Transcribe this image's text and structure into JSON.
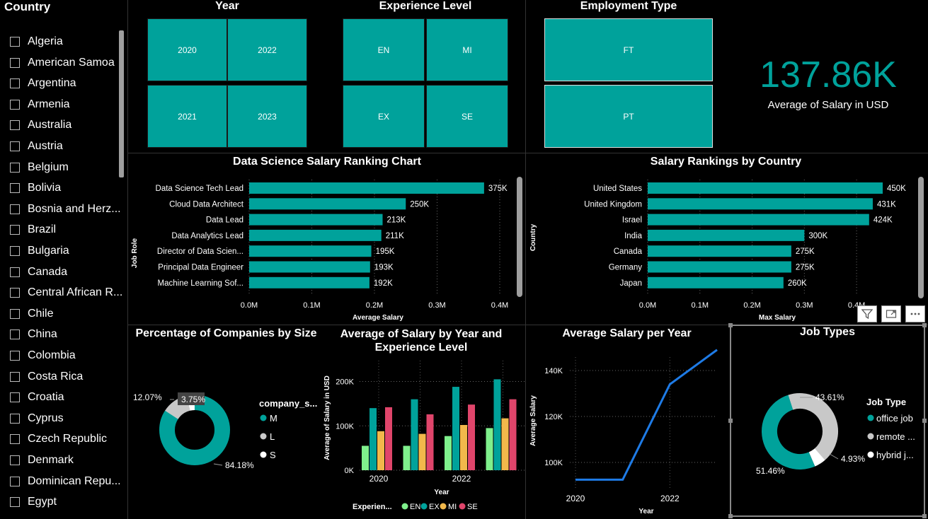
{
  "sidebar": {
    "title": "Country",
    "countries": [
      "Algeria",
      "American Samoa",
      "Argentina",
      "Armenia",
      "Australia",
      "Austria",
      "Belgium",
      "Bolivia",
      "Bosnia and Herz...",
      "Brazil",
      "Bulgaria",
      "Canada",
      "Central African R...",
      "Chile",
      "China",
      "Colombia",
      "Costa Rica",
      "Croatia",
      "Cyprus",
      "Czech Republic",
      "Denmark",
      "Dominican Repu...",
      "Egypt"
    ]
  },
  "slicers": {
    "year": {
      "title": "Year",
      "options": [
        "2020",
        "2022",
        "2021",
        "2023"
      ]
    },
    "experience": {
      "title": "Experience Level",
      "options": [
        "EN",
        "MI",
        "EX",
        "SE"
      ]
    },
    "employment": {
      "title": "Employment Type",
      "options": [
        "FT",
        "PT"
      ]
    }
  },
  "kpi": {
    "value": "137.86K",
    "label": "Average of Salary in USD"
  },
  "colors": {
    "teal": "#00a29b",
    "line": "#1e7be6",
    "en": "#7ff08c",
    "mi": "#f2b84b",
    "se": "#e0456b",
    "grey": "#c8c8c8"
  },
  "chart_data": [
    {
      "id": "role",
      "type": "bar",
      "orientation": "horizontal",
      "title": "Data Science Salary Ranking Chart",
      "xlabel": "Average Salary",
      "ylabel": "Job Role",
      "categories": [
        "Data Science Tech Lead",
        "Cloud Data Architect",
        "Data Lead",
        "Data Analytics Lead",
        "Director of Data Scien...",
        "Principal Data Engineer",
        "Machine Learning Sof..."
      ],
      "values": [
        375000,
        250000,
        213000,
        211000,
        195000,
        193000,
        192000
      ],
      "data_labels": [
        "375K",
        "250K",
        "213K",
        "211K",
        "195K",
        "193K",
        "192K"
      ],
      "xlim": [
        0,
        400000
      ],
      "xticks": [
        "0.0M",
        "0.1M",
        "0.2M",
        "0.3M",
        "0.4M"
      ],
      "grid": true
    },
    {
      "id": "country",
      "type": "bar",
      "orientation": "horizontal",
      "title": "Salary Rankings by Country",
      "xlabel": "Max Salary",
      "ylabel": "Country",
      "categories": [
        "United States",
        "United Kingdom",
        "Israel",
        "India",
        "Canada",
        "Germany",
        "Japan"
      ],
      "values": [
        450000,
        431000,
        424000,
        300000,
        275000,
        275000,
        260000
      ],
      "data_labels": [
        "450K",
        "431K",
        "424K",
        "300K",
        "275K",
        "275K",
        "260K"
      ],
      "xlim": [
        0,
        450000
      ],
      "xticks": [
        "0.0M",
        "0.1M",
        "0.2M",
        "0.3M",
        "0.4M"
      ],
      "grid": true
    },
    {
      "id": "size",
      "type": "pie",
      "donut": true,
      "title": "Percentage of Companies by Size",
      "legend_title": "company_s...",
      "categories": [
        "M",
        "L",
        "S"
      ],
      "values": [
        84.18,
        12.07,
        3.75
      ],
      "data_labels": [
        "84.18%",
        "12.07%",
        "3.75%"
      ],
      "colors": [
        "#00a29b",
        "#c8c8c8",
        "#ffffff"
      ],
      "legend": "right"
    },
    {
      "id": "yearexp",
      "type": "bar",
      "title": "Average of Salary by Year and Experience Level",
      "xlabel": "Year",
      "ylabel": "Average of Salary in USD",
      "categories": [
        "2020",
        "2021",
        "2022",
        "2023"
      ],
      "xtick_labels": [
        "2020",
        "",
        "2022",
        ""
      ],
      "legend_title": "Experien...",
      "series": [
        {
          "name": "EN",
          "values": [
            55000,
            55000,
            77000,
            95000
          ]
        },
        {
          "name": "EX",
          "values": [
            140000,
            160000,
            188000,
            205000
          ]
        },
        {
          "name": "MI",
          "values": [
            88000,
            82000,
            102000,
            117000
          ]
        },
        {
          "name": "SE",
          "values": [
            142000,
            126000,
            148000,
            160000
          ]
        }
      ],
      "ylim": [
        0,
        220000
      ],
      "yticks": [
        "0K",
        "100K",
        "200K"
      ],
      "grid": true,
      "legend": "bottom"
    },
    {
      "id": "avgyear",
      "type": "line",
      "title": "Average Salary per Year",
      "xlabel": "Year",
      "ylabel": "Average Salary",
      "x": [
        2020,
        2021,
        2022,
        2023
      ],
      "y": [
        92500,
        92500,
        134000,
        149000
      ],
      "xtick_labels": [
        "2020",
        "2022"
      ],
      "yticks": [
        "100K",
        "120K",
        "140K"
      ],
      "ylim": [
        88000,
        152000
      ],
      "grid": true
    },
    {
      "id": "jobtype",
      "type": "pie",
      "donut": true,
      "title": "Job Types",
      "legend_title": "Job Type",
      "categories": [
        "office job",
        "remote ...",
        "hybrid j..."
      ],
      "values": [
        51.46,
        43.61,
        4.93
      ],
      "data_labels": [
        "51.46%",
        "43.61%",
        "4.93%"
      ],
      "colors": [
        "#00a29b",
        "#c8c8c8",
        "#ffffff"
      ],
      "legend": "right"
    }
  ]
}
